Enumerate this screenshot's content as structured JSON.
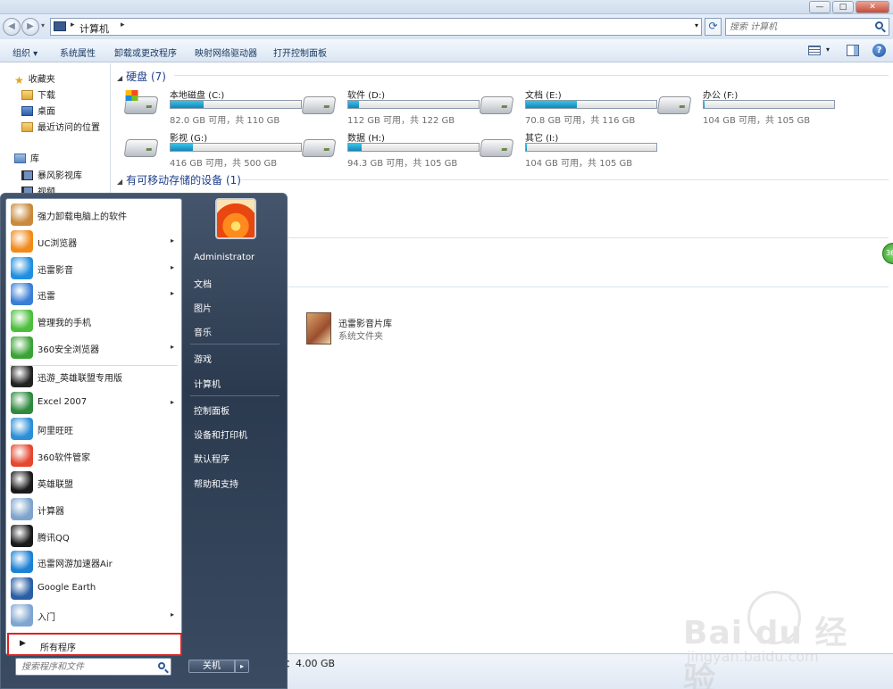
{
  "window": {
    "controls": {
      "minimize": "—",
      "maximize": "□",
      "close": "✕"
    }
  },
  "address": {
    "path": "计算机",
    "search_placeholder": "搜索 计算机"
  },
  "toolbar": {
    "organize": "组织 ▾",
    "system_props": "系统属性",
    "uninstall": "卸载或更改程序",
    "map_drive": "映射网络驱动器",
    "control_panel": "打开控制面板"
  },
  "navpane": {
    "favorites": "收藏夹",
    "downloads": "下载",
    "desktop": "桌面",
    "recent": "最近访问的位置",
    "libraries": "库",
    "storm": "暴风影视库",
    "videos": "视频"
  },
  "content": {
    "hard_disks_header": "硬盘 (7)",
    "removable_header": "有可移动存储的设备 (1)",
    "drives": [
      {
        "name": "本地磁盘 (C:)",
        "info": "82.0 GB 可用，共 110 GB",
        "used": 0.25
      },
      {
        "name": "软件 (D:)",
        "info": "112 GB 可用，共 122 GB",
        "used": 0.08
      },
      {
        "name": "文档 (E:)",
        "info": "70.8 GB 可用，共 116 GB",
        "used": 0.39
      },
      {
        "name": "办公 (F:)",
        "info": "104 GB 可用，共 105 GB",
        "used": 0.01
      },
      {
        "name": "影视 (G:)",
        "info": "416 GB 可用，共 500 GB",
        "used": 0.17
      },
      {
        "name": "数据 (H:)",
        "info": "94.3 GB 可用，共 105 GB",
        "used": 0.1
      },
      {
        "name": "其它 (I:)",
        "info": "104 GB 可用，共 105 GB",
        "used": 0.01
      }
    ],
    "folder_name": "迅雷影音片库",
    "folder_type": "系统文件夹",
    "side_badge": "36"
  },
  "status": {
    "memory": "：4.00 GB"
  },
  "startmenu": {
    "programs": [
      {
        "label": "强力卸载电脑上的软件",
        "arrow": false,
        "color": "#c98a3c"
      },
      {
        "label": "UC浏览器",
        "arrow": true,
        "color": "#f28a1a"
      },
      {
        "label": "迅雷影音",
        "arrow": true,
        "color": "#1f8fe0"
      },
      {
        "label": "迅雷",
        "arrow": true,
        "color": "#3a7fd6"
      },
      {
        "label": "管理我的手机",
        "arrow": false,
        "color": "#4cbf3c"
      },
      {
        "label": "360安全浏览器",
        "arrow": true,
        "color": "#3aa335"
      },
      {
        "label": "迅游_英雄联盟专用版",
        "arrow": false,
        "color": "#222222"
      },
      {
        "label": "Excel 2007",
        "arrow": true,
        "color": "#2f8a3e"
      },
      {
        "label": "阿里旺旺",
        "arrow": false,
        "color": "#2b8fd8"
      },
      {
        "label": "360软件管家",
        "arrow": false,
        "color": "#e5472f"
      },
      {
        "label": "英雄联盟",
        "arrow": false,
        "color": "#1b1b1b"
      },
      {
        "label": "计算器",
        "arrow": false,
        "color": "#7ea4cc"
      },
      {
        "label": "腾讯QQ",
        "arrow": false,
        "color": "#1a1a1a"
      },
      {
        "label": "迅雷网游加速器Air",
        "arrow": false,
        "color": "#1d82d6"
      },
      {
        "label": "Google Earth",
        "arrow": false,
        "color": "#2a5fa6"
      },
      {
        "label": "入门",
        "arrow": true,
        "color": "#7fa6d1"
      }
    ],
    "arrow_glyph": "▸",
    "all_programs": "所有程序",
    "search_placeholder": "搜索程序和文件",
    "right": {
      "user": "Administrator",
      "documents": "文档",
      "pictures": "图片",
      "music": "音乐",
      "games": "游戏",
      "computer": "计算机",
      "control_panel": "控制面板",
      "devices": "设备和打印机",
      "defaults": "默认程序",
      "help": "帮助和支持"
    },
    "shutdown": "关机"
  },
  "watermark": {
    "brand": "Bai du 经验",
    "url": "jingyan.baidu.com"
  }
}
